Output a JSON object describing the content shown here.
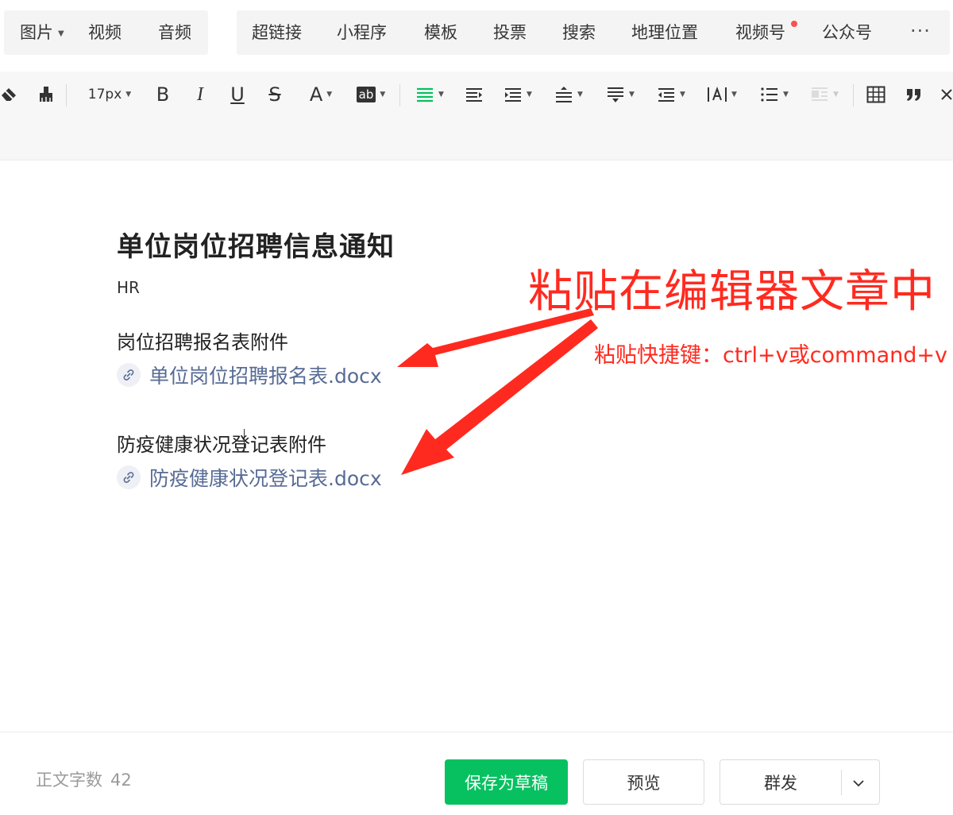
{
  "insert_menu": {
    "group1": [
      {
        "label": "图片",
        "dropdown": true
      },
      {
        "label": "视频",
        "dropdown": false
      },
      {
        "label": "音频",
        "dropdown": false
      }
    ],
    "group2": [
      {
        "label": "超链接"
      },
      {
        "label": "小程序"
      },
      {
        "label": "模板"
      },
      {
        "label": "投票"
      },
      {
        "label": "搜索"
      },
      {
        "label": "地理位置"
      },
      {
        "label": "视频号",
        "badge": "red-dot"
      },
      {
        "label": "公众号"
      }
    ],
    "more_label": "···"
  },
  "toolbar": {
    "font_size": "17px",
    "bold_label": "B",
    "italic_label": "I",
    "underline_label": "U",
    "strike_label": "S",
    "font_color_label": "A",
    "highlight_label": "ab",
    "icons": [
      "eraser-icon",
      "format-painter-icon",
      "align-left-icon",
      "indent-icon",
      "first-line-indent-icon",
      "line-height-icon",
      "paragraph-spacing-icon",
      "outdent-icon",
      "letter-spacing-icon",
      "bullet-list-icon",
      "float-icon",
      "table-icon",
      "quote-icon"
    ],
    "active_color": "#07c160"
  },
  "article": {
    "title": "单位岗位招聘信息通知",
    "author": "HR",
    "sections": [
      {
        "heading": "岗位招聘报名表附件",
        "link": "单位岗位招聘报名表.docx"
      },
      {
        "heading": "防疫健康状况登记表附件",
        "link": "防疫健康状况登记表.docx"
      }
    ]
  },
  "annotation": {
    "headline": "粘贴在编辑器文章中",
    "hint": "粘贴快捷键：ctrl+v或command+v",
    "color": "#ff2a1f"
  },
  "footer": {
    "word_count_label": "正文字数",
    "word_count_value": "42",
    "save_draft_label": "保存为草稿",
    "preview_label": "预览",
    "mass_send_label": "群发"
  },
  "colors": {
    "primary_green": "#07c160",
    "link_blue": "#576b95",
    "badge_red": "#fa5151"
  }
}
